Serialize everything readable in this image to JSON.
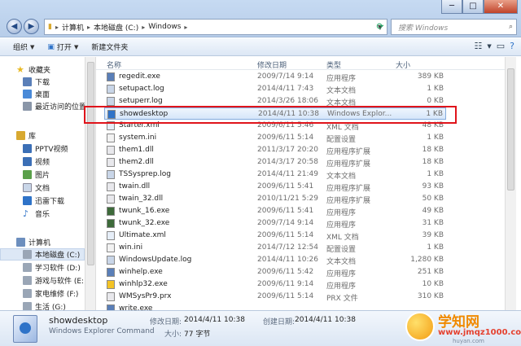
{
  "address": {
    "crumbs": [
      "计算机",
      "本地磁盘 (C:)",
      "Windows"
    ],
    "separator": "▸",
    "search_placeholder": "搜索 Windows"
  },
  "window_buttons": {
    "minimize": "─",
    "maximize": "□",
    "close": "✕"
  },
  "toolbar": {
    "organize": "组织",
    "open": "打开",
    "new_folder": "新建文件夹"
  },
  "nav": {
    "favorites": "收藏夹",
    "downloads": "下载",
    "desktop": "桌面",
    "recent": "最近访问的位置",
    "libraries": "库",
    "pptv": "PPTV视频",
    "videos": "视频",
    "pictures": "图片",
    "documents": "文档",
    "xunlei": "迅雷下载",
    "music": "音乐",
    "computer": "计算机",
    "drive_c": "本地磁盘 (C:)",
    "drive_d": "学习软件 (D:)",
    "drive_e": "游戏与软件 (E:)",
    "drive_f": "家电维修 (F:)",
    "drive_g": "生活 (G:)"
  },
  "columns": {
    "name": "名称",
    "date": "修改日期",
    "type": "类型",
    "size": "大小"
  },
  "files": [
    {
      "name": "regedit.exe",
      "date": "2009/7/14 9:14",
      "type": "应用程序",
      "size": "389 KB"
    },
    {
      "name": "setupact.log",
      "date": "2014/4/11 7:43",
      "type": "文本文档",
      "size": "1 KB"
    },
    {
      "name": "setuperr.log",
      "date": "2014/3/26 18:06",
      "type": "文本文档",
      "size": "0 KB"
    },
    {
      "name": "showdesktop",
      "date": "2014/4/11 10:38",
      "type": "Windows Explor...",
      "size": "1 KB"
    },
    {
      "name": "Starter.xml",
      "date": "2009/6/11 5:46",
      "type": "XML 文档",
      "size": "48 KB"
    },
    {
      "name": "system.ini",
      "date": "2009/6/11 5:14",
      "type": "配置设置",
      "size": "1 KB"
    },
    {
      "name": "them1.dll",
      "date": "2011/3/17 20:20",
      "type": "应用程序扩展",
      "size": "18 KB"
    },
    {
      "name": "them2.dll",
      "date": "2014/3/17 20:58",
      "type": "应用程序扩展",
      "size": "18 KB"
    },
    {
      "name": "TSSysprep.log",
      "date": "2014/4/11 21:49",
      "type": "文本文档",
      "size": "1 KB"
    },
    {
      "name": "twain.dll",
      "date": "2009/6/11 5:41",
      "type": "应用程序扩展",
      "size": "93 KB"
    },
    {
      "name": "twain_32.dll",
      "date": "2010/11/21 5:29",
      "type": "应用程序扩展",
      "size": "50 KB"
    },
    {
      "name": "twunk_16.exe",
      "date": "2009/6/11 5:41",
      "type": "应用程序",
      "size": "49 KB"
    },
    {
      "name": "twunk_32.exe",
      "date": "2009/7/14 9:14",
      "type": "应用程序",
      "size": "31 KB"
    },
    {
      "name": "Ultimate.xml",
      "date": "2009/6/11 5:14",
      "type": "XML 文档",
      "size": "39 KB"
    },
    {
      "name": "win.ini",
      "date": "2014/7/12 12:54",
      "type": "配置设置",
      "size": "1 KB"
    },
    {
      "name": "WindowsUpdate.log",
      "date": "2014/4/11 10:26",
      "type": "文本文档",
      "size": "1,280 KB"
    },
    {
      "name": "winhelp.exe",
      "date": "2009/6/11 5:42",
      "type": "应用程序",
      "size": "251 KB"
    },
    {
      "name": "winhlp32.exe",
      "date": "2009/6/11 9:14",
      "type": "应用程序",
      "size": "10 KB"
    },
    {
      "name": "WMSysPr9.prx",
      "date": "2009/6/11 5:14",
      "type": "PRX 文件",
      "size": "310 KB"
    },
    {
      "name": "write.exe",
      "date": "",
      "type": "",
      "size": ""
    }
  ],
  "details": {
    "name": "showdesktop",
    "type": "Windows Explorer Command",
    "modified_label": "修改日期:",
    "modified": "2014/4/11 10:38",
    "created_label": "创建日期:",
    "created": "2014/4/11 10:38",
    "size_label": "大小:",
    "size": "77 字节"
  },
  "watermark": {
    "line1": "学知网",
    "line2": "www.jmqz1000.com",
    "line3": "huyan.com"
  },
  "colors": {
    "highlight": "#e0141b",
    "selection": "#d6e6fa",
    "accent": "#2f73c8"
  }
}
